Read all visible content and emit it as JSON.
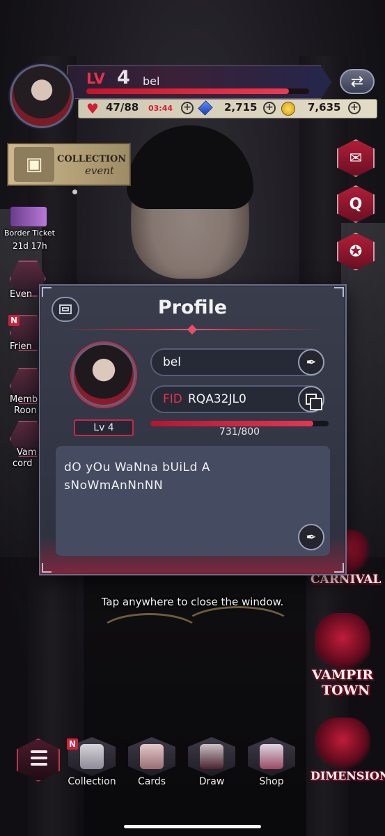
{
  "hud": {
    "level_label": "LV",
    "level": "4",
    "username": "bel",
    "xp_fraction": 0.91,
    "stamina": "47/88",
    "stamina_timer": "03:44",
    "gems": "2,715",
    "coins": "7,635"
  },
  "event": {
    "title": "COLLECTION",
    "subtitle": "event"
  },
  "left_menu": {
    "border_ticket_label": "Border Ticket",
    "border_ticket_time": "21d 17h",
    "event_label": "Even",
    "friends_label": "Frien",
    "member_label_1": "Memb",
    "member_label_2": "Roon",
    "vamp_label_1": "Vam",
    "vamp_label_2": "cord",
    "badge": "N"
  },
  "right_menu": {
    "help_label": "Q",
    "mail_icon": "mail-icon",
    "award_icon": "award-icon"
  },
  "places": {
    "carnival": "CARNIVAL",
    "vampir": "VAMPIR",
    "town": "TOWN",
    "dimension": "DIMENSION"
  },
  "profile": {
    "title": "Profile",
    "level": "Lv 4",
    "name": "bel",
    "fid_label": "FID",
    "fid_value": "RQA32JL0",
    "xp_text": "731/800",
    "xp_fraction": 0.914,
    "bio_line1": "dO yOu WaNna bUiLd A",
    "bio_line2": "sNoWmAnNnNN"
  },
  "close_hint": "Tap anywhere to close the window.",
  "nav": {
    "collection": "Collection",
    "cards": "Cards",
    "draw": "Draw",
    "shop": "Shop",
    "badge": "N"
  },
  "colors": {
    "accent_red": "#e8324a",
    "modal_bg": "#393d4c"
  }
}
